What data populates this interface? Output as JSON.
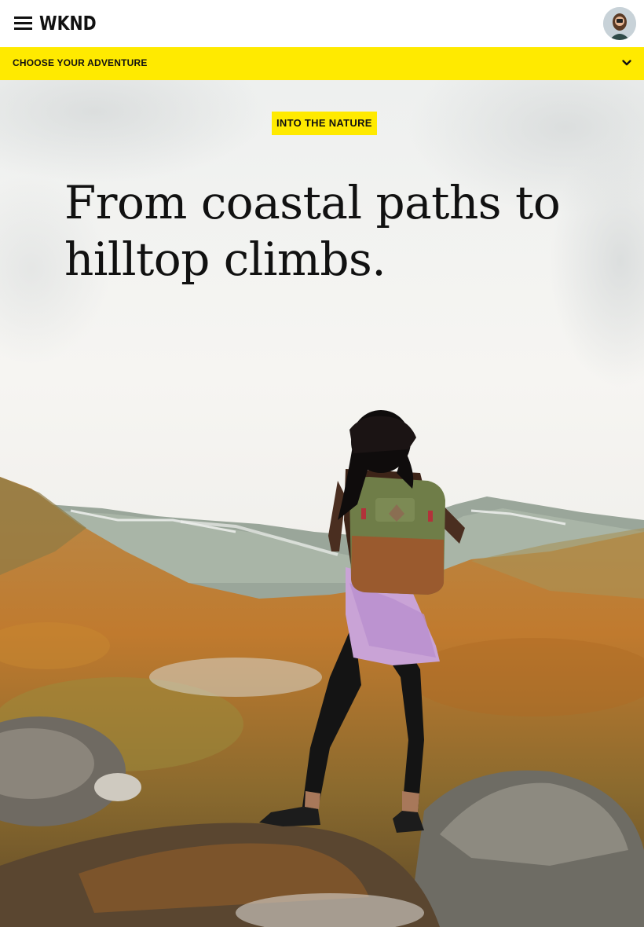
{
  "header": {
    "logo_text": "WKND",
    "menu_icon": "hamburger-menu-icon",
    "avatar_icon": "user-avatar-icon"
  },
  "adventure_bar": {
    "label": "CHOOSE YOUR ADVENTURE",
    "icon": "chevron-down-icon",
    "background": "#ffea00"
  },
  "hero": {
    "tag": "INTO THE NATURE",
    "headline": "From coastal paths to hilltop climbs."
  },
  "colors": {
    "accent": "#ffea00",
    "text": "#111111",
    "header_bg": "#ffffff"
  }
}
